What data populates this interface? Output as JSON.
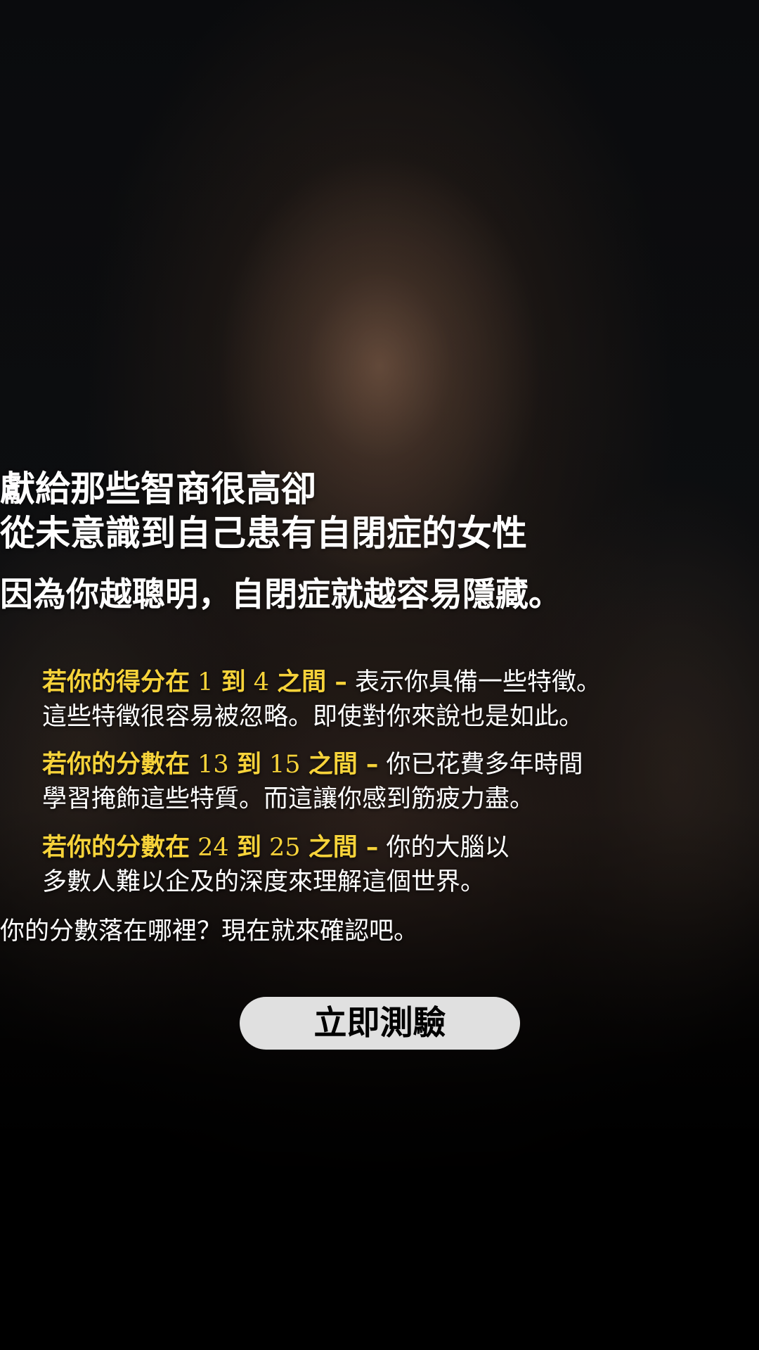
{
  "headline": {
    "line1": "獻給那些智商很高卻",
    "line2": "從未意識到自己患有自閉症的女性"
  },
  "subheadline": "因為你越聰明，自閉症就越容易隱藏。",
  "tiers": [
    {
      "prefix": "若你的得分在",
      "low": "1",
      "mid": "到",
      "high": "4",
      "suffix": "之間 –",
      "text1": "表示你具備一些特徵。",
      "text2": "這些特徵很容易被忽略。即使對你來說也是如此。"
    },
    {
      "prefix": "若你的分數在",
      "low": "13",
      "mid": "到",
      "high": "15",
      "suffix": "之間 –",
      "text1": "你已花費多年時間",
      "text2": "學習掩飾這些特質。而這讓你感到筋疲力盡。"
    },
    {
      "prefix": "若你的分數在",
      "low": "24",
      "mid": "到",
      "high": "25",
      "suffix": "之間 –",
      "text1": "你的大腦以",
      "text2": "多數人難以企及的深度來理解這個世界。"
    },
    {}
  ],
  "prompt": "你的分數落在哪裡？現在就來確認吧。",
  "cta_label": "立即測驗",
  "colors": {
    "highlight": "#f7d33a",
    "button_bg": "#e0e0e0",
    "text": "#ffffff"
  }
}
